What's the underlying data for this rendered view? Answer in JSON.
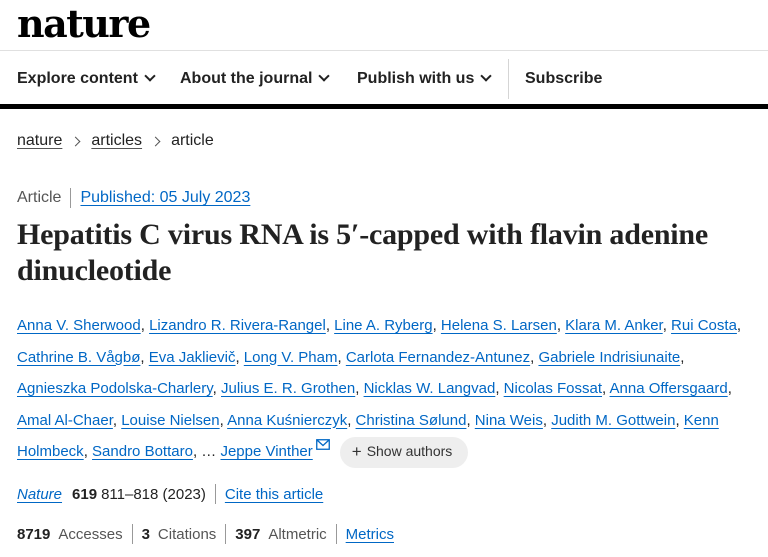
{
  "site": {
    "logo": "nature"
  },
  "nav": {
    "items": [
      {
        "label": "Explore content"
      },
      {
        "label": "About the journal"
      },
      {
        "label": "Publish with us"
      }
    ],
    "subscribe": "Subscribe"
  },
  "breadcrumb": [
    "nature",
    "articles",
    "article"
  ],
  "article": {
    "type": "Article",
    "published": "Published: 05 July 2023",
    "title": "Hepatitis C virus RNA is 5′-capped with flavin adenine dinucleotide"
  },
  "authors": [
    "Anna V. Sherwood",
    "Lizandro R. Rivera-Rangel",
    "Line A. Ryberg",
    "Helena S. Larsen",
    "Klara M. Anker",
    "Rui Costa",
    "Cathrine B. Vågbø",
    "Eva Jaklievič",
    "Long V. Pham",
    "Carlota Fernandez-Antunez",
    "Gabriele Indrisiunaite",
    "Agnieszka Podolska-Charlery",
    "Julius E. R. Grothen",
    "Nicklas W. Langvad",
    "Nicolas Fossat",
    "Anna Offersgaard",
    "Amal Al-Chaer",
    "Louise Nielsen",
    "Anna Kuśnierczyk",
    "Christina Sølund",
    "Nina Weis",
    "Judith M. Gottwein",
    "Kenn Holmbeck",
    "Sandro Bottaro"
  ],
  "authors_ellipsis": "…",
  "last_author": "Jeppe Vinther",
  "show_authors_label": "Show authors",
  "citation": {
    "journal": "Nature",
    "volume": "619",
    "pages_year": "811–818 (2023)",
    "cite_label": "Cite this article"
  },
  "metrics": {
    "accesses_value": "8719",
    "accesses_label": "Accesses",
    "citations_value": "3",
    "citations_label": "Citations",
    "altmetric_value": "397",
    "altmetric_label": "Altmetric",
    "metrics_link": "Metrics"
  },
  "colors": {
    "link": "#0067c5",
    "text": "#222222",
    "rule": "#000000"
  },
  "icons": [
    "chevron-down-icon",
    "chevron-right-icon",
    "mail-icon",
    "plus-icon"
  ]
}
